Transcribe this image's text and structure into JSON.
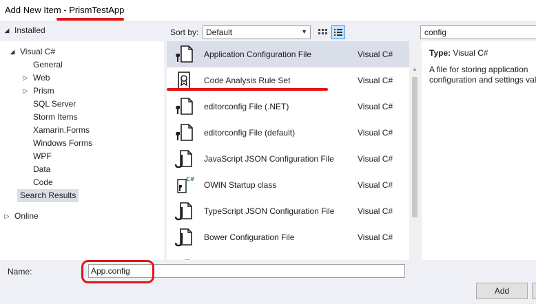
{
  "window": {
    "title": "Add New Item - PrismTestApp"
  },
  "tree": {
    "installed_label": "Installed",
    "visual_csharp_label": "Visual C#",
    "children": [
      "General",
      "Web",
      "Prism",
      "SQL Server",
      "Storm Items",
      "Xamarin.Forms",
      "Windows Forms",
      "WPF",
      "Data",
      "Code"
    ],
    "search_results_label": "Search Results",
    "online_label": "Online"
  },
  "toolbar": {
    "sort_by_label": "Sort by:",
    "sort_value": "Default",
    "search_value": "config"
  },
  "templates": [
    {
      "name": "Application Configuration File",
      "lang": "Visual C#",
      "icon": "config-file-icon"
    },
    {
      "name": "Code Analysis Rule Set",
      "lang": "Visual C#",
      "icon": "ruleset-icon"
    },
    {
      "name": "editorconfig File (.NET)",
      "lang": "Visual C#",
      "icon": "config-file-icon"
    },
    {
      "name": "editorconfig File (default)",
      "lang": "Visual C#",
      "icon": "config-file-icon"
    },
    {
      "name": "JavaScript JSON Configuration File",
      "lang": "Visual C#",
      "icon": "json-config-icon"
    },
    {
      "name": "OWIN Startup class",
      "lang": "Visual C#",
      "icon": "csharp-class-icon"
    },
    {
      "name": "TypeScript JSON Configuration File",
      "lang": "Visual C#",
      "icon": "json-config-icon"
    },
    {
      "name": "Bower Configuration File",
      "lang": "Visual C#",
      "icon": "json-config-icon"
    }
  ],
  "details": {
    "type_label": "Type:",
    "type_value": "Visual C#",
    "description": "A file for storing application configuration and settings values"
  },
  "bottom": {
    "name_label": "Name:",
    "name_value": "App.config",
    "add_label": "Add"
  },
  "colors": {
    "annotation_red": "#e0161a",
    "selection": "#dadee8"
  }
}
